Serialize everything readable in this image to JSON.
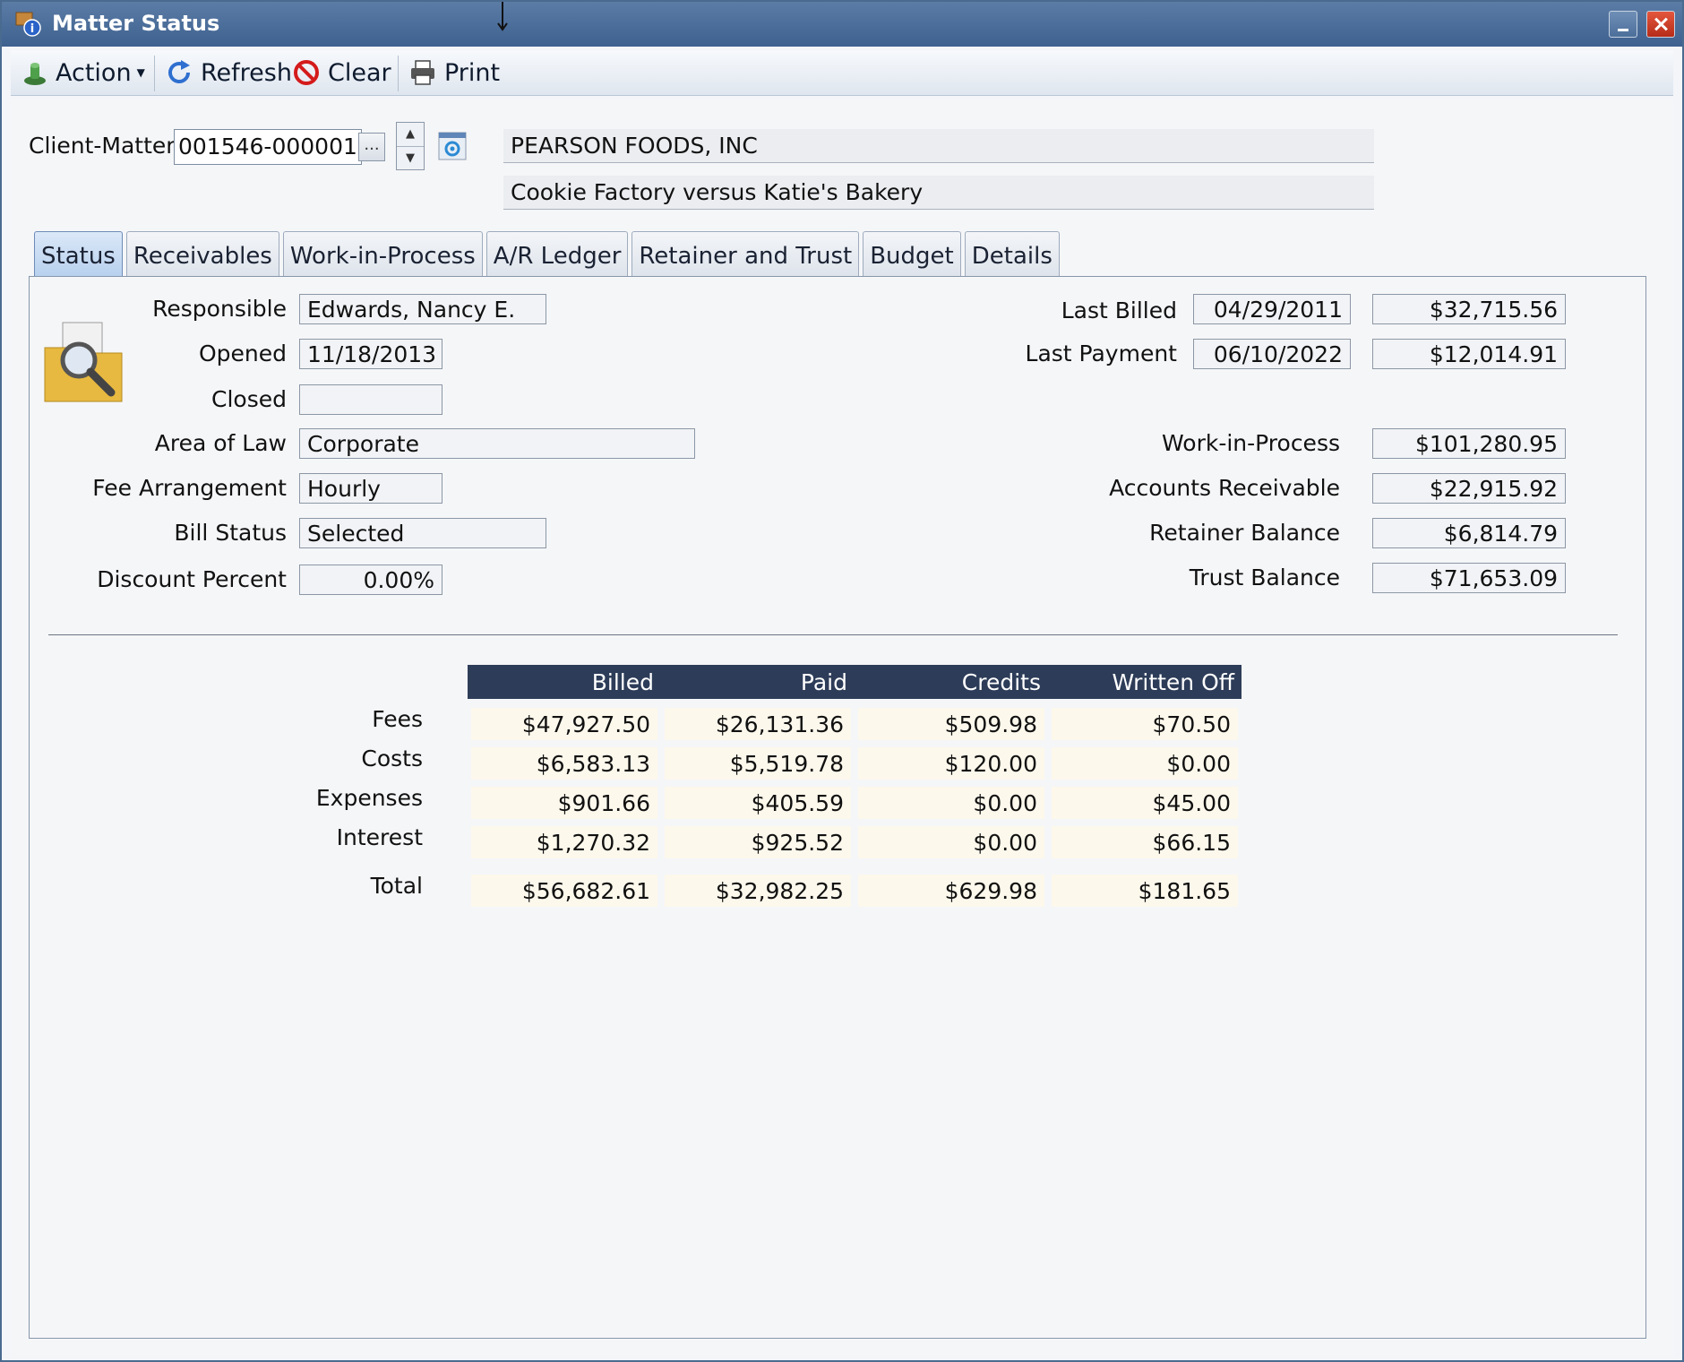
{
  "window": {
    "title": "Matter Status"
  },
  "toolbar": {
    "action": "Action",
    "refresh": "Refresh",
    "clear": "Clear",
    "print": "Print"
  },
  "client_matter": {
    "label": "Client-Matter",
    "value": "001546-000001",
    "ellipsis": "...",
    "client_name": "PEARSON FOODS, INC",
    "matter_description": "Cookie Factory versus Katie's Bakery"
  },
  "tabs": [
    "Status",
    "Receivables",
    "Work-in-Process",
    "A/R Ledger",
    "Retainer and Trust",
    "Budget",
    "Details"
  ],
  "status": {
    "responsible": {
      "label": "Responsible",
      "value": "Edwards, Nancy E."
    },
    "opened": {
      "label": "Opened",
      "value": "11/18/2013"
    },
    "closed": {
      "label": "Closed",
      "value": ""
    },
    "area_of_law": {
      "label": "Area of Law",
      "value": "Corporate"
    },
    "fee_arrangement": {
      "label": "Fee Arrangement",
      "value": "Hourly"
    },
    "bill_status": {
      "label": "Bill Status",
      "value": "Selected"
    },
    "discount_percent": {
      "label": "Discount Percent",
      "value": "0.00%"
    }
  },
  "balances": {
    "last_billed": {
      "label": "Last Billed",
      "date": "04/29/2011",
      "amount": "$32,715.56"
    },
    "last_payment": {
      "label": "Last Payment",
      "date": "06/10/2022",
      "amount": "$12,014.91"
    },
    "work_in_process": {
      "label": "Work-in-Process",
      "value": "$101,280.95"
    },
    "accounts_receivable": {
      "label": "Accounts Receivable",
      "value": "$22,915.92"
    },
    "retainer_balance": {
      "label": "Retainer Balance",
      "value": "$6,814.79"
    },
    "trust_balance": {
      "label": "Trust Balance",
      "value": "$71,653.09"
    }
  },
  "summary": {
    "columns": [
      "Billed",
      "Paid",
      "Credits",
      "Written Off"
    ],
    "rows": [
      {
        "label": "Fees",
        "values": [
          "$47,927.50",
          "$26,131.36",
          "$509.98",
          "$70.50"
        ]
      },
      {
        "label": "Costs",
        "values": [
          "$6,583.13",
          "$5,519.78",
          "$120.00",
          "$0.00"
        ]
      },
      {
        "label": "Expenses",
        "values": [
          "$901.66",
          "$405.59",
          "$0.00",
          "$45.00"
        ]
      },
      {
        "label": "Interest",
        "values": [
          "$1,270.32",
          "$925.52",
          "$0.00",
          "$66.15"
        ]
      },
      {
        "label": "Total",
        "values": [
          "$56,682.61",
          "$32,982.25",
          "$629.98",
          "$181.65"
        ]
      }
    ]
  }
}
